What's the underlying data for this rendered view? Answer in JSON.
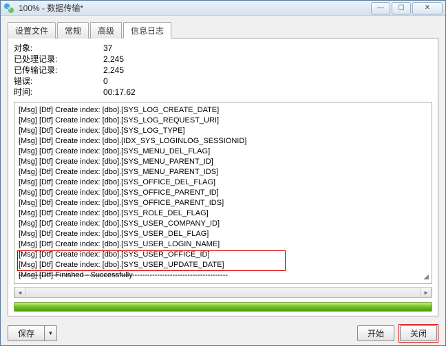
{
  "window": {
    "title": "100% - 数据传输*"
  },
  "tabs": [
    {
      "label": "设置文件",
      "active": false
    },
    {
      "label": "常规",
      "active": false
    },
    {
      "label": "高级",
      "active": false
    },
    {
      "label": "信息日志",
      "active": true
    }
  ],
  "summary": {
    "object_label": "对象:",
    "object_value": "37",
    "processed_label": "已处理记录:",
    "processed_value": "2,245",
    "transferred_label": "已传输记录:",
    "transferred_value": "2,245",
    "error_label": "错误:",
    "error_value": "0",
    "time_label": "时间:",
    "time_value": "00:17.62"
  },
  "log_lines": [
    "[Msg] [Dtf] Create index: [dbo].[SYS_LOG_CREATE_DATE]",
    "[Msg] [Dtf] Create index: [dbo].[SYS_LOG_REQUEST_URI]",
    "[Msg] [Dtf] Create index: [dbo].[SYS_LOG_TYPE]",
    "[Msg] [Dtf] Create index: [dbo].[IDX_SYS_LOGINLOG_SESSIONID]",
    "[Msg] [Dtf] Create index: [dbo].[SYS_MENU_DEL_FLAG]",
    "[Msg] [Dtf] Create index: [dbo].[SYS_MENU_PARENT_ID]",
    "[Msg] [Dtf] Create index: [dbo].[SYS_MENU_PARENT_IDS]",
    "[Msg] [Dtf] Create index: [dbo].[SYS_OFFICE_DEL_FLAG]",
    "[Msg] [Dtf] Create index: [dbo].[SYS_OFFICE_PARENT_ID]",
    "[Msg] [Dtf] Create index: [dbo].[SYS_OFFICE_PARENT_IDS]",
    "[Msg] [Dtf] Create index: [dbo].[SYS_ROLE_DEL_FLAG]",
    "[Msg] [Dtf] Create index: [dbo].[SYS_USER_COMPANY_ID]",
    "[Msg] [Dtf] Create index: [dbo].[SYS_USER_DEL_FLAG]",
    "[Msg] [Dtf] Create index: [dbo].[SYS_USER_LOGIN_NAME]",
    "[Msg] [Dtf] Create index: [dbo].[SYS_USER_OFFICE_ID]",
    "[Msg] [Dtf] Create index: [dbo].[SYS_USER_UPDATE_DATE]",
    "[Msg] [Dtf] Finished - Successfully"
  ],
  "buttons": {
    "save": "保存",
    "start": "开始",
    "close": "关闭"
  }
}
